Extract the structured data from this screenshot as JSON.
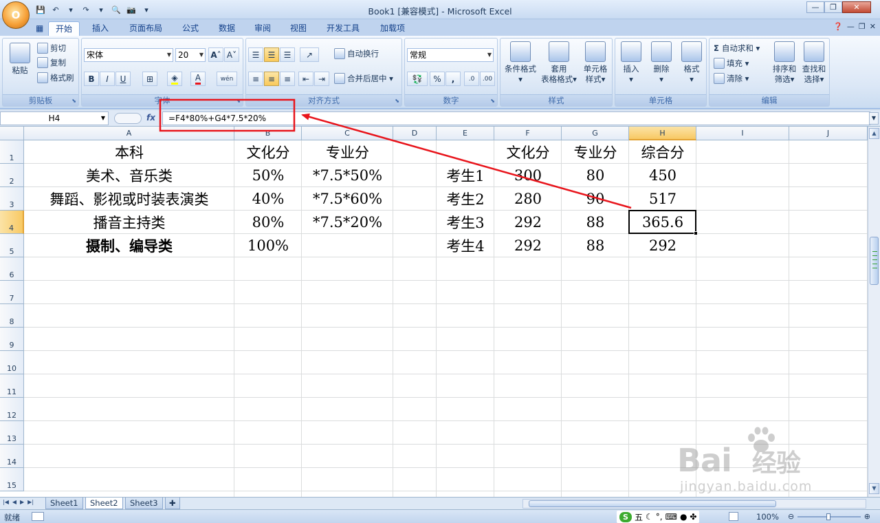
{
  "window": {
    "title": "Book1  [兼容模式] - Microsoft Excel",
    "office_button": "O"
  },
  "tabs": [
    {
      "label": "开始",
      "active": true
    },
    {
      "label": "插入"
    },
    {
      "label": "页面布局"
    },
    {
      "label": "公式"
    },
    {
      "label": "数据"
    },
    {
      "label": "审阅"
    },
    {
      "label": "视图"
    },
    {
      "label": "开发工具"
    },
    {
      "label": "加载项"
    }
  ],
  "ribbon": {
    "clipboard": {
      "label": "剪贴板",
      "paste": "粘贴",
      "cut": "剪切",
      "copy": "复制",
      "format_painter": "格式刷"
    },
    "font": {
      "label": "字体",
      "name": "宋体",
      "size": "20",
      "bold": "B",
      "italic": "I",
      "underline": "U",
      "grow": "A",
      "shrink": "A",
      "color": "A",
      "phonetic": "wén"
    },
    "alignment": {
      "label": "对齐方式",
      "wrap": "自动换行",
      "merge": "合并后居中"
    },
    "number": {
      "label": "数字",
      "format": "常规",
      "percent": "%",
      "comma": ","
    },
    "styles": {
      "label": "样式",
      "conditional_line1": "条件格式",
      "table_line1": "套用",
      "table_line2": "表格格式",
      "cell_line1": "单元格",
      "cell_line2": "样式"
    },
    "cells": {
      "label": "单元格",
      "insert": "插入",
      "delete": "删除",
      "format": "格式"
    },
    "editing": {
      "label": "编辑",
      "autosum": "自动求和",
      "fill": "填充",
      "clear": "清除",
      "sort_line1": "排序和",
      "sort_line2": "筛选",
      "find_line1": "查找和",
      "find_line2": "选择"
    }
  },
  "formula_bar": {
    "name_box": "H4",
    "fx": "fx",
    "formula": "=F4*80%+G4*7.5*20%"
  },
  "columns": [
    "A",
    "B",
    "C",
    "D",
    "E",
    "F",
    "G",
    "H",
    "I",
    "J"
  ],
  "rows": [
    "1",
    "2",
    "3",
    "4",
    "5",
    "6",
    "7",
    "8",
    "9",
    "10",
    "11",
    "12",
    "13",
    "14",
    "15"
  ],
  "cells": {
    "A1": "本科",
    "B1": "文化分",
    "C1": "专业分",
    "F1": "文化分",
    "G1": "专业分",
    "H1": "综合分",
    "A2": "美术、音乐类",
    "B2": "50%",
    "C2": "*7.5*50%",
    "E2": "考生1",
    "F2": "300",
    "G2": "80",
    "H2": "450",
    "A3": "舞蹈、影视或时装表演类",
    "B3": "40%",
    "C3": "*7.5*60%",
    "E3": "考生2",
    "F3": "280",
    "G3": "90",
    "H3": "517",
    "A4": "播音主持类",
    "B4": "80%",
    "C4": "*7.5*20%",
    "E4": "考生3",
    "F4": "292",
    "G4": "88",
    "H4": "365.6",
    "A5": "摄制、编导类",
    "B5": "100%",
    "E5": "考生4",
    "F5": "292",
    "G5": "88",
    "H5": "292"
  },
  "active_cell": "H4",
  "sheets": [
    {
      "label": "Sheet1"
    },
    {
      "label": "Sheet2",
      "active": true
    },
    {
      "label": "Sheet3"
    }
  ],
  "status": {
    "ready": "就绪",
    "zoom": "100%",
    "ime_mode": "五"
  },
  "watermark": {
    "brand": "Bai",
    "brand_tail": "经验",
    "url": "jingyan.baidu.com"
  },
  "colors": {
    "annotation": "#e8141b",
    "selection_header": "#f8c964",
    "ribbon_bg": "#dbe7f6"
  }
}
